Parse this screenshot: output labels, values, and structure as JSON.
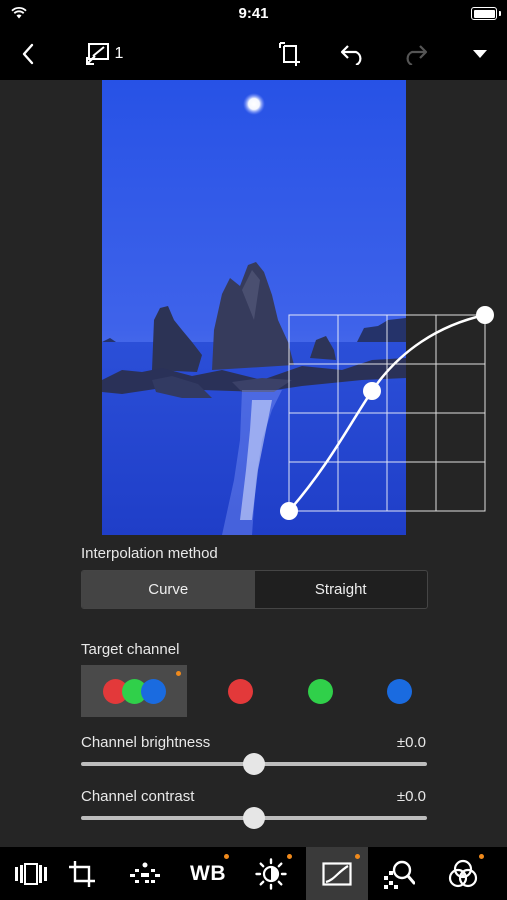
{
  "status_bar": {
    "time": "9:41"
  },
  "toolbar": {
    "layer_count": "1",
    "icons": [
      "back-icon",
      "overlay-compare-icon",
      "crop-rotate-icon",
      "undo-icon",
      "redo-icon",
      "dropdown-icon"
    ]
  },
  "settings": {
    "interpolation_label": "Interpolation method",
    "interpolation_options": [
      "Curve",
      "Straight"
    ],
    "interpolation_selected": "Curve",
    "target_channel_label": "Target channel",
    "channels": [
      "rgb",
      "red",
      "green",
      "blue"
    ],
    "channel_selected": "rgb",
    "channel_brightness_label": "Channel brightness",
    "channel_brightness_value": "±0.0",
    "channel_brightness_level": 0.5,
    "channel_contrast_label": "Channel contrast",
    "channel_contrast_value": "±0.0",
    "channel_contrast_level": 0.5
  },
  "tabs": [
    {
      "icon": "filmstrip-icon"
    },
    {
      "icon": "crop-icon"
    },
    {
      "icon": "picture-style-icon"
    },
    {
      "icon": "wb-icon",
      "label": "WB"
    },
    {
      "icon": "brightness-icon"
    },
    {
      "icon": "tone-curve-icon",
      "active": true
    },
    {
      "icon": "sharpness-icon"
    },
    {
      "icon": "color-icon"
    }
  ],
  "colors": {
    "accent": "#f08a1c",
    "red": "#e3393a",
    "green": "#30d04a",
    "blue": "#1a6be0"
  }
}
